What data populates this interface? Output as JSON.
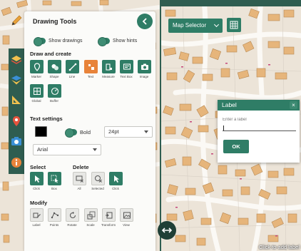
{
  "panel": {
    "title": "Drawing Tools",
    "show_drawings": "Show drawings",
    "show_hints": "Show hints"
  },
  "draw_section": {
    "title": "Draw and create",
    "tools": [
      {
        "label": "Marker",
        "icon": "marker-icon"
      },
      {
        "label": "Shape",
        "icon": "shape-icon"
      },
      {
        "label": "Line",
        "icon": "line-icon"
      },
      {
        "label": "Text",
        "icon": "text-icon",
        "active": true
      },
      {
        "label": "Measure",
        "icon": "measure-icon"
      },
      {
        "label": "Text Box",
        "icon": "text-box-icon"
      },
      {
        "label": "Image",
        "icon": "image-icon"
      }
    ],
    "tools_row2": [
      {
        "label": "Global",
        "icon": "global-icon"
      },
      {
        "label": "Buffer",
        "icon": "buffer-icon"
      }
    ]
  },
  "text_settings": {
    "title": "Text settings",
    "bold_label": "Bold",
    "size_value": "24pt",
    "font_value": "Arial",
    "swatch_color": "#000000"
  },
  "select_section": {
    "title": "Select",
    "tools": [
      {
        "label": "Click"
      },
      {
        "label": "Box"
      }
    ]
  },
  "delete_section": {
    "title": "Delete",
    "tools": [
      {
        "label": "All"
      },
      {
        "label": "Selected"
      },
      {
        "label": "Click"
      }
    ]
  },
  "modify_section": {
    "title": "Modify",
    "tools": [
      {
        "label": "Label"
      },
      {
        "label": "Points"
      },
      {
        "label": "Rotate"
      },
      {
        "label": "Scale"
      },
      {
        "label": "Transform"
      },
      {
        "label": "View"
      }
    ]
  },
  "map_selector": {
    "label": "Map Selector"
  },
  "label_dialog": {
    "title": "Label",
    "close": "×",
    "placeholder": "Enter a label",
    "ok": "OK"
  },
  "status": "Click to add label",
  "colors": {
    "accent": "#2f7d66",
    "active": "#e8833a",
    "rail": "#2f5d50"
  }
}
